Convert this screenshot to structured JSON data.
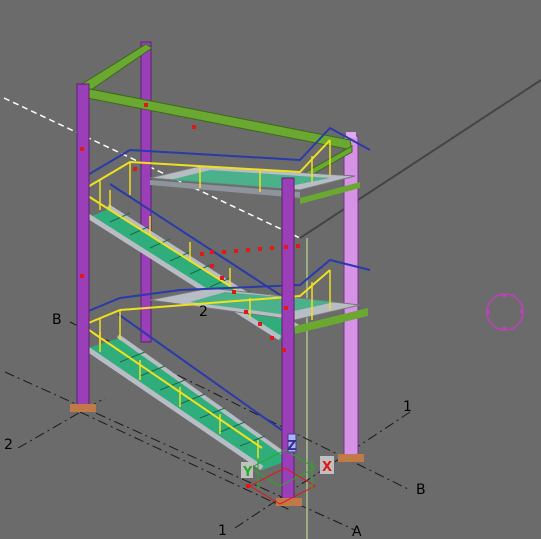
{
  "viewport": {
    "background": "#6b6b6b"
  },
  "grid_labels": {
    "b_left": "B",
    "two_left": "2",
    "one_right": "1",
    "b_right": "B",
    "one_bottom": "1",
    "a_bottom": "A",
    "two_center": "2"
  },
  "triad": {
    "x": "X",
    "y": "Y",
    "z": "Z"
  },
  "colors": {
    "column": "#9b3fb8",
    "column_light": "#d693e6",
    "beam": "#6aa832",
    "handrail": "#f0e020",
    "guardrail_blue": "#2a3aa8",
    "stair_tread": "#2fae7c",
    "stringer": "#b8bcc4",
    "marker": "#e01818",
    "gridline": "#1a1a1a",
    "workplane": "#c8f0a0"
  }
}
